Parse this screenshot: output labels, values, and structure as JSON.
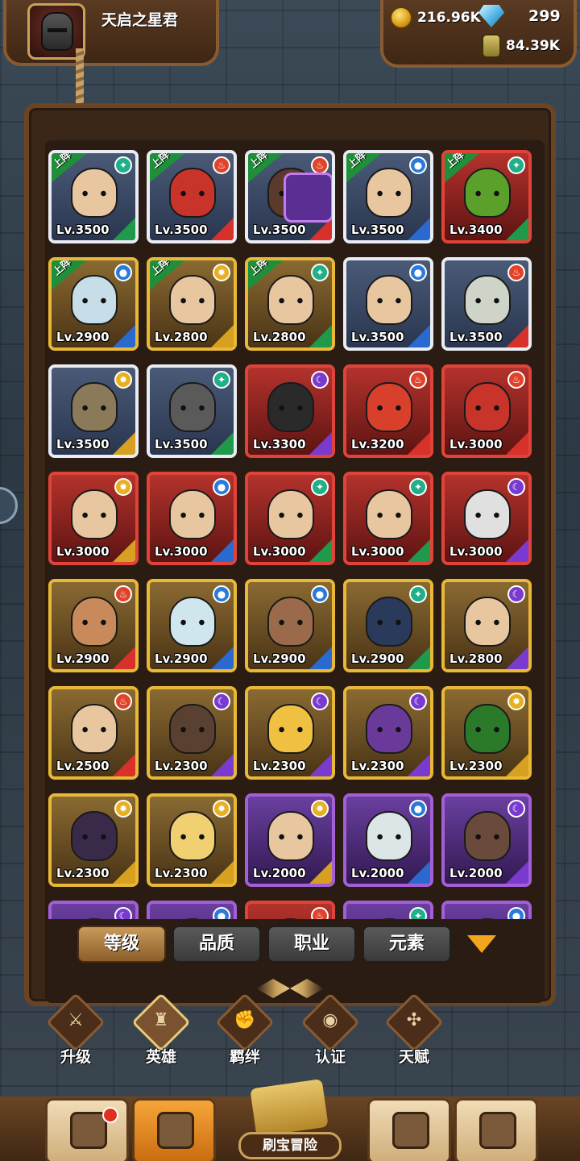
{
  "player": {
    "name": "天启之星君"
  },
  "currency": {
    "gold": "216.96K",
    "gems": "299",
    "essence": "84.39K"
  },
  "deploy_label": "上阵",
  "heroes": [
    {
      "lv": "Lv.3500",
      "rarity": "white",
      "deployed": true,
      "elem": "wind",
      "job": "green",
      "skin": "#e8c7a0"
    },
    {
      "lv": "Lv.3500",
      "rarity": "white",
      "deployed": true,
      "elem": "fire",
      "job": "red",
      "skin": "#c8332a"
    },
    {
      "lv": "Lv.3500",
      "rarity": "white",
      "deployed": true,
      "elem": "fire",
      "job": "red",
      "skin": "#5a3a2a",
      "badge": true
    },
    {
      "lv": "Lv.3500",
      "rarity": "white",
      "deployed": true,
      "elem": "water",
      "job": "blue",
      "skin": "#e8c7a0"
    },
    {
      "lv": "Lv.3400",
      "rarity": "red",
      "deployed": true,
      "elem": "wind",
      "job": "green",
      "skin": "#5aa02a"
    },
    {
      "lv": "Lv.2900",
      "rarity": "gold",
      "deployed": true,
      "elem": "water",
      "job": "blue",
      "skin": "#c7dde8"
    },
    {
      "lv": "Lv.2800",
      "rarity": "gold",
      "deployed": true,
      "elem": "light",
      "job": "gold",
      "skin": "#e8c7a0"
    },
    {
      "lv": "Lv.2800",
      "rarity": "gold",
      "deployed": true,
      "elem": "wind",
      "job": "green",
      "skin": "#e8c7a0"
    },
    {
      "lv": "Lv.3500",
      "rarity": "white",
      "deployed": false,
      "elem": "water",
      "job": "blue",
      "skin": "#e8c7a0"
    },
    {
      "lv": "Lv.3500",
      "rarity": "white",
      "deployed": false,
      "elem": "fire",
      "job": "red",
      "skin": "#cfd4c8"
    },
    {
      "lv": "Lv.3500",
      "rarity": "white",
      "deployed": false,
      "elem": "light",
      "job": "gold",
      "skin": "#8a7a5a"
    },
    {
      "lv": "Lv.3500",
      "rarity": "white",
      "deployed": false,
      "elem": "wind",
      "job": "green",
      "skin": "#5a5a5a"
    },
    {
      "lv": "Lv.3300",
      "rarity": "red",
      "deployed": false,
      "elem": "dark",
      "job": "purple",
      "skin": "#2a2a2a"
    },
    {
      "lv": "Lv.3200",
      "rarity": "red",
      "deployed": false,
      "elem": "fire",
      "job": "red",
      "skin": "#d8402c"
    },
    {
      "lv": "Lv.3000",
      "rarity": "red",
      "deployed": false,
      "elem": "fire",
      "job": "red",
      "skin": "#c8332a"
    },
    {
      "lv": "Lv.3000",
      "rarity": "red",
      "deployed": false,
      "elem": "light",
      "job": "gold",
      "skin": "#e8c7a0"
    },
    {
      "lv": "Lv.3000",
      "rarity": "red",
      "deployed": false,
      "elem": "water",
      "job": "blue",
      "skin": "#e8c7a0"
    },
    {
      "lv": "Lv.3000",
      "rarity": "red",
      "deployed": false,
      "elem": "wind",
      "job": "green",
      "skin": "#e8c7a0"
    },
    {
      "lv": "Lv.3000",
      "rarity": "red",
      "deployed": false,
      "elem": "wind",
      "job": "green",
      "skin": "#e8c7a0"
    },
    {
      "lv": "Lv.3000",
      "rarity": "red",
      "deployed": false,
      "elem": "dark",
      "job": "purple",
      "skin": "#e0e0e0"
    },
    {
      "lv": "Lv.2900",
      "rarity": "gold",
      "deployed": false,
      "elem": "fire",
      "job": "red",
      "skin": "#c88a5a"
    },
    {
      "lv": "Lv.2900",
      "rarity": "gold",
      "deployed": false,
      "elem": "water",
      "job": "blue",
      "skin": "#cfe6ee"
    },
    {
      "lv": "Lv.2900",
      "rarity": "gold",
      "deployed": false,
      "elem": "water",
      "job": "blue",
      "skin": "#9a6a4a"
    },
    {
      "lv": "Lv.2900",
      "rarity": "gold",
      "deployed": false,
      "elem": "wind",
      "job": "green",
      "skin": "#2a3a5a"
    },
    {
      "lv": "Lv.2800",
      "rarity": "gold",
      "deployed": false,
      "elem": "dark",
      "job": "purple",
      "skin": "#e8c7a0"
    },
    {
      "lv": "Lv.2500",
      "rarity": "gold",
      "deployed": false,
      "elem": "fire",
      "job": "red",
      "skin": "#e8c7a0"
    },
    {
      "lv": "Lv.2300",
      "rarity": "gold",
      "deployed": false,
      "elem": "dark",
      "job": "purple",
      "skin": "#5a4030"
    },
    {
      "lv": "Lv.2300",
      "rarity": "gold",
      "deployed": false,
      "elem": "dark",
      "job": "purple",
      "skin": "#f0c040"
    },
    {
      "lv": "Lv.2300",
      "rarity": "gold",
      "deployed": false,
      "elem": "dark",
      "job": "purple",
      "skin": "#6a3a9a"
    },
    {
      "lv": "Lv.2300",
      "rarity": "gold",
      "deployed": false,
      "elem": "light",
      "job": "gold",
      "skin": "#2a7a2a"
    },
    {
      "lv": "Lv.2300",
      "rarity": "gold",
      "deployed": false,
      "elem": "light",
      "job": "gold",
      "skin": "#3a2a4a"
    },
    {
      "lv": "Lv.2300",
      "rarity": "gold",
      "deployed": false,
      "elem": "light",
      "job": "gold",
      "skin": "#f0d070"
    },
    {
      "lv": "Lv.2000",
      "rarity": "purple",
      "deployed": false,
      "elem": "light",
      "job": "gold",
      "skin": "#e8c7a0"
    },
    {
      "lv": "Lv.2000",
      "rarity": "purple",
      "deployed": false,
      "elem": "water",
      "job": "blue",
      "skin": "#dce6e6"
    },
    {
      "lv": "Lv.2000",
      "rarity": "purple",
      "deployed": false,
      "elem": "dark",
      "job": "purple",
      "skin": "#6a4a3a"
    },
    {
      "lv": "",
      "rarity": "purple",
      "deployed": false,
      "elem": "dark",
      "job": "purple",
      "skin": "#6a4a3a"
    },
    {
      "lv": "",
      "rarity": "purple",
      "deployed": false,
      "elem": "water",
      "job": "blue",
      "skin": "#6a4a3a"
    },
    {
      "lv": "",
      "rarity": "red",
      "deployed": false,
      "elem": "fire",
      "job": "red",
      "skin": "#6a4a3a"
    },
    {
      "lv": "",
      "rarity": "purple",
      "deployed": false,
      "elem": "wind",
      "job": "green",
      "skin": "#6a4a3a"
    },
    {
      "lv": "",
      "rarity": "purple",
      "deployed": false,
      "elem": "water",
      "job": "blue",
      "skin": "#6a4a3a"
    }
  ],
  "element_colors": {
    "wind": "#1fb08a",
    "fire": "#e0432a",
    "water": "#2a7ad8",
    "light": "#e8b020",
    "dark": "#7a3ad0"
  },
  "element_glyphs": {
    "wind": "✦",
    "fire": "♨",
    "water": "●",
    "light": "✹",
    "dark": "☾"
  },
  "job_colors": {
    "green": "#1f9a4a",
    "red": "#d8302a",
    "blue": "#2a6ad0",
    "gold": "#d8a020",
    "purple": "#7a3ad0"
  },
  "filters": [
    "等级",
    "品质",
    "职业",
    "元素"
  ],
  "subnav": [
    {
      "label": "升级",
      "icon": "sword-icon"
    },
    {
      "label": "英雄",
      "icon": "hero-icon",
      "active": true
    },
    {
      "label": "羁绊",
      "icon": "handshake-icon"
    },
    {
      "label": "认证",
      "icon": "eye-icon"
    },
    {
      "label": "天赋",
      "icon": "talent-icon"
    }
  ],
  "bottom_nav": {
    "adventure_label": "刷宝冒险"
  }
}
